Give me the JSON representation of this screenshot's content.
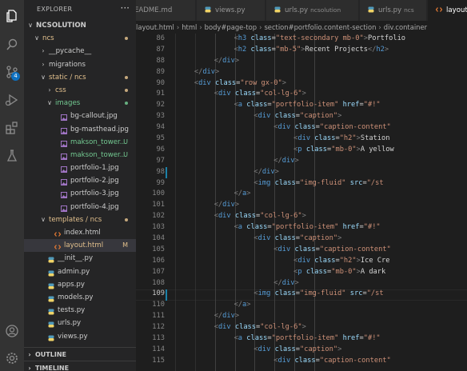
{
  "explorer": {
    "title": "EXPLORER",
    "more": "···",
    "tree": [
      {
        "label": "NCSOLUTION",
        "indent": 0,
        "chev": "∨",
        "icon": "none",
        "color": "#cccccc",
        "status": "",
        "bold": true
      },
      {
        "label": "ncs",
        "indent": 1,
        "chev": "∨",
        "icon": "none",
        "color": "#e2c08d",
        "status": "dot-yellow"
      },
      {
        "label": "__pycache__",
        "indent": 2,
        "chev": "›",
        "icon": "none",
        "color": "#cccccc",
        "status": ""
      },
      {
        "label": "migrations",
        "indent": 2,
        "chev": "›",
        "icon": "none",
        "color": "#cccccc",
        "status": ""
      },
      {
        "label": "static / ncs",
        "indent": 2,
        "chev": "∨",
        "icon": "none",
        "color": "#e2c08d",
        "status": "dot-yellow"
      },
      {
        "label": "css",
        "indent": 3,
        "chev": "›",
        "icon": "none",
        "color": "#e2c08d",
        "status": "dot-yellow"
      },
      {
        "label": "images",
        "indent": 3,
        "chev": "∨",
        "icon": "none",
        "color": "#73c991",
        "status": "dot-green"
      },
      {
        "label": "bg-callout.jpg",
        "indent": 4,
        "chev": "",
        "icon": "img",
        "color": "#cccccc",
        "status": ""
      },
      {
        "label": "bg-masthead.jpg",
        "indent": 4,
        "chev": "",
        "icon": "img",
        "color": "#cccccc",
        "status": ""
      },
      {
        "label": "makson_tower...",
        "indent": 4,
        "chev": "",
        "icon": "img",
        "color": "#73c991",
        "status": "U"
      },
      {
        "label": "makson_tower...",
        "indent": 4,
        "chev": "",
        "icon": "img",
        "color": "#73c991",
        "status": "U"
      },
      {
        "label": "portfolio-1.jpg",
        "indent": 4,
        "chev": "",
        "icon": "img",
        "color": "#cccccc",
        "status": ""
      },
      {
        "label": "portfolio-2.jpg",
        "indent": 4,
        "chev": "",
        "icon": "img",
        "color": "#cccccc",
        "status": ""
      },
      {
        "label": "portfolio-3.jpg",
        "indent": 4,
        "chev": "",
        "icon": "img",
        "color": "#cccccc",
        "status": ""
      },
      {
        "label": "portfolio-4.jpg",
        "indent": 4,
        "chev": "",
        "icon": "img",
        "color": "#cccccc",
        "status": ""
      },
      {
        "label": "templates / ncs",
        "indent": 2,
        "chev": "∨",
        "icon": "none",
        "color": "#e2c08d",
        "status": "dot-yellow"
      },
      {
        "label": "index.html",
        "indent": 3,
        "chev": "",
        "icon": "html",
        "color": "#cccccc",
        "status": ""
      },
      {
        "label": "layout.html",
        "indent": 3,
        "chev": "",
        "icon": "html",
        "color": "#e2c08d",
        "status": "M",
        "selected": true
      },
      {
        "label": "__init__.py",
        "indent": 2,
        "chev": "",
        "icon": "py",
        "color": "#cccccc",
        "status": ""
      },
      {
        "label": "admin.py",
        "indent": 2,
        "chev": "",
        "icon": "py",
        "color": "#cccccc",
        "status": ""
      },
      {
        "label": "apps.py",
        "indent": 2,
        "chev": "",
        "icon": "py",
        "color": "#cccccc",
        "status": ""
      },
      {
        "label": "models.py",
        "indent": 2,
        "chev": "",
        "icon": "py",
        "color": "#cccccc",
        "status": ""
      },
      {
        "label": "tests.py",
        "indent": 2,
        "chev": "",
        "icon": "py",
        "color": "#cccccc",
        "status": ""
      },
      {
        "label": "urls.py",
        "indent": 2,
        "chev": "",
        "icon": "py",
        "color": "#cccccc",
        "status": ""
      },
      {
        "label": "views.py",
        "indent": 2,
        "chev": "",
        "icon": "py",
        "color": "#cccccc",
        "status": ""
      }
    ],
    "outline": "OUTLINE",
    "timeline": "TIMELINE",
    "collapsed_chev": "›"
  },
  "activity_badge": "4",
  "tabs": [
    {
      "label": "README.md",
      "sub": "",
      "icon": "md"
    },
    {
      "label": "views.py",
      "sub": "",
      "icon": "py"
    },
    {
      "label": "urls.py",
      "sub": "ncsolution",
      "icon": "py"
    },
    {
      "label": "urls.py",
      "sub": "ncs",
      "icon": "py"
    },
    {
      "label": "layout.html",
      "sub": "",
      "icon": "html",
      "active": true
    }
  ],
  "breadcrumbs": [
    "layout.html",
    "›",
    "html",
    "›",
    "body#page-top",
    "›",
    "section#portfolio.content-section",
    "›",
    "div.container"
  ],
  "editor": {
    "first_line": 86,
    "current_line": 109,
    "modified_lines": [
      98,
      109
    ],
    "lines": [
      {
        "i": 5,
        "t": [
          [
            "pun",
            "<"
          ],
          [
            "tag",
            "h3"
          ],
          [
            "atr",
            " class"
          ],
          [
            "eq",
            "="
          ],
          [
            "str",
            "\"text-secondary mb-0\""
          ],
          [
            "pun",
            ">"
          ],
          [
            "txt",
            "Portfolio"
          ]
        ]
      },
      {
        "i": 5,
        "t": [
          [
            "pun",
            "<"
          ],
          [
            "tag",
            "h2"
          ],
          [
            "atr",
            " class"
          ],
          [
            "eq",
            "="
          ],
          [
            "str",
            "\"mb-5\""
          ],
          [
            "pun",
            ">"
          ],
          [
            "txt",
            "Recent Projects"
          ],
          [
            "pun",
            "</"
          ],
          [
            "tag",
            "h2"
          ],
          [
            "pun",
            ">"
          ]
        ]
      },
      {
        "i": 4,
        "t": [
          [
            "pun",
            "</"
          ],
          [
            "tag",
            "div"
          ],
          [
            "pun",
            ">"
          ]
        ]
      },
      {
        "i": 3,
        "t": [
          [
            "pun",
            "</"
          ],
          [
            "tag",
            "div"
          ],
          [
            "pun",
            ">"
          ]
        ]
      },
      {
        "i": 3,
        "t": [
          [
            "pun",
            "<"
          ],
          [
            "tag",
            "div"
          ],
          [
            "atr",
            " class"
          ],
          [
            "eq",
            "="
          ],
          [
            "str",
            "\"row gx-0\""
          ],
          [
            "pun",
            ">"
          ]
        ]
      },
      {
        "i": 4,
        "t": [
          [
            "pun",
            "<"
          ],
          [
            "tag",
            "div"
          ],
          [
            "atr",
            " class"
          ],
          [
            "eq",
            "="
          ],
          [
            "str",
            "\"col-lg-6\""
          ],
          [
            "pun",
            ">"
          ]
        ]
      },
      {
        "i": 5,
        "t": [
          [
            "pun",
            "<"
          ],
          [
            "tag",
            "a"
          ],
          [
            "atr",
            " class"
          ],
          [
            "eq",
            "="
          ],
          [
            "str",
            "\"portfolio-item\""
          ],
          [
            "atr",
            " href"
          ],
          [
            "eq",
            "="
          ],
          [
            "str",
            "\"#!\""
          ]
        ]
      },
      {
        "i": 6,
        "t": [
          [
            "pun",
            "<"
          ],
          [
            "tag",
            "div"
          ],
          [
            "atr",
            " class"
          ],
          [
            "eq",
            "="
          ],
          [
            "str",
            "\"caption\""
          ],
          [
            "pun",
            ">"
          ]
        ]
      },
      {
        "i": 7,
        "t": [
          [
            "pun",
            "<"
          ],
          [
            "tag",
            "div"
          ],
          [
            "atr",
            " class"
          ],
          [
            "eq",
            "="
          ],
          [
            "str",
            "\"caption-content\""
          ]
        ]
      },
      {
        "i": 8,
        "t": [
          [
            "pun",
            "<"
          ],
          [
            "tag",
            "div"
          ],
          [
            "atr",
            " class"
          ],
          [
            "eq",
            "="
          ],
          [
            "str",
            "\"h2\""
          ],
          [
            "pun",
            ">"
          ],
          [
            "txt",
            "Station"
          ]
        ]
      },
      {
        "i": 8,
        "t": [
          [
            "pun",
            "<"
          ],
          [
            "tag",
            "p"
          ],
          [
            "atr",
            " class"
          ],
          [
            "eq",
            "="
          ],
          [
            "str",
            "\"mb-0\""
          ],
          [
            "pun",
            ">"
          ],
          [
            "txt",
            "A yellow"
          ]
        ]
      },
      {
        "i": 7,
        "t": [
          [
            "pun",
            "</"
          ],
          [
            "tag",
            "div"
          ],
          [
            "pun",
            ">"
          ]
        ]
      },
      {
        "i": 6,
        "t": [
          [
            "pun",
            "</"
          ],
          [
            "tag",
            "div"
          ],
          [
            "pun",
            ">"
          ]
        ]
      },
      {
        "i": 6,
        "t": [
          [
            "pun",
            "<"
          ],
          [
            "tag",
            "img"
          ],
          [
            "atr",
            " class"
          ],
          [
            "eq",
            "="
          ],
          [
            "str",
            "\"img-fluid\""
          ],
          [
            "atr",
            " src"
          ],
          [
            "eq",
            "="
          ],
          [
            "str",
            "\"/st"
          ]
        ]
      },
      {
        "i": 5,
        "t": [
          [
            "pun",
            "</"
          ],
          [
            "tag",
            "a"
          ],
          [
            "pun",
            ">"
          ]
        ]
      },
      {
        "i": 4,
        "t": [
          [
            "pun",
            "</"
          ],
          [
            "tag",
            "div"
          ],
          [
            "pun",
            ">"
          ]
        ]
      },
      {
        "i": 4,
        "t": [
          [
            "pun",
            "<"
          ],
          [
            "tag",
            "div"
          ],
          [
            "atr",
            " class"
          ],
          [
            "eq",
            "="
          ],
          [
            "str",
            "\"col-lg-6\""
          ],
          [
            "pun",
            ">"
          ]
        ]
      },
      {
        "i": 5,
        "t": [
          [
            "pun",
            "<"
          ],
          [
            "tag",
            "a"
          ],
          [
            "atr",
            " class"
          ],
          [
            "eq",
            "="
          ],
          [
            "str",
            "\"portfolio-item\""
          ],
          [
            "atr",
            " href"
          ],
          [
            "eq",
            "="
          ],
          [
            "str",
            "\"#!\""
          ]
        ]
      },
      {
        "i": 6,
        "t": [
          [
            "pun",
            "<"
          ],
          [
            "tag",
            "div"
          ],
          [
            "atr",
            " class"
          ],
          [
            "eq",
            "="
          ],
          [
            "str",
            "\"caption\""
          ],
          [
            "pun",
            ">"
          ]
        ]
      },
      {
        "i": 7,
        "t": [
          [
            "pun",
            "<"
          ],
          [
            "tag",
            "div"
          ],
          [
            "atr",
            " class"
          ],
          [
            "eq",
            "="
          ],
          [
            "str",
            "\"caption-content\""
          ]
        ]
      },
      {
        "i": 8,
        "t": [
          [
            "pun",
            "<"
          ],
          [
            "tag",
            "div"
          ],
          [
            "atr",
            " class"
          ],
          [
            "eq",
            "="
          ],
          [
            "str",
            "\"h2\""
          ],
          [
            "pun",
            ">"
          ],
          [
            "txt",
            "Ice Cre"
          ]
        ]
      },
      {
        "i": 8,
        "t": [
          [
            "pun",
            "<"
          ],
          [
            "tag",
            "p"
          ],
          [
            "atr",
            " class"
          ],
          [
            "eq",
            "="
          ],
          [
            "str",
            "\"mb-0\""
          ],
          [
            "pun",
            ">"
          ],
          [
            "txt",
            "A dark"
          ]
        ]
      },
      {
        "i": 7,
        "t": [
          [
            "pun",
            "</"
          ],
          [
            "tag",
            "div"
          ],
          [
            "pun",
            ">"
          ]
        ]
      },
      {
        "i": 6,
        "t": [
          [
            "pun",
            "<"
          ],
          [
            "tag",
            "img"
          ],
          [
            "atr",
            " class"
          ],
          [
            "eq",
            "="
          ],
          [
            "str",
            "\"img-fluid\""
          ],
          [
            "atr",
            " src"
          ],
          [
            "eq",
            "="
          ],
          [
            "str",
            "\"/st"
          ]
        ]
      },
      {
        "i": 5,
        "t": [
          [
            "pun",
            "</"
          ],
          [
            "tag",
            "a"
          ],
          [
            "pun",
            ">"
          ]
        ]
      },
      {
        "i": 4,
        "t": [
          [
            "pun",
            "</"
          ],
          [
            "tag",
            "div"
          ],
          [
            "pun",
            ">"
          ]
        ]
      },
      {
        "i": 4,
        "t": [
          [
            "pun",
            "<"
          ],
          [
            "tag",
            "div"
          ],
          [
            "atr",
            " class"
          ],
          [
            "eq",
            "="
          ],
          [
            "str",
            "\"col-lg-6\""
          ],
          [
            "pun",
            ">"
          ]
        ]
      },
      {
        "i": 5,
        "t": [
          [
            "pun",
            "<"
          ],
          [
            "tag",
            "a"
          ],
          [
            "atr",
            " class"
          ],
          [
            "eq",
            "="
          ],
          [
            "str",
            "\"portfolio-item\""
          ],
          [
            "atr",
            " href"
          ],
          [
            "eq",
            "="
          ],
          [
            "str",
            "\"#!\""
          ]
        ]
      },
      {
        "i": 6,
        "t": [
          [
            "pun",
            "<"
          ],
          [
            "tag",
            "div"
          ],
          [
            "atr",
            " class"
          ],
          [
            "eq",
            "="
          ],
          [
            "str",
            "\"caption\""
          ],
          [
            "pun",
            ">"
          ]
        ]
      },
      {
        "i": 7,
        "t": [
          [
            "pun",
            "<"
          ],
          [
            "tag",
            "div"
          ],
          [
            "atr",
            " class"
          ],
          [
            "eq",
            "="
          ],
          [
            "str",
            "\"caption-content\""
          ]
        ]
      }
    ]
  },
  "colors": {
    "accent_blue": "#0e70c0",
    "untracked_green": "#73c991",
    "modified_yellow": "#e2c08d",
    "html_icon": "#e37933",
    "py_icon": "#519aba",
    "img_icon": "#a074c4"
  }
}
